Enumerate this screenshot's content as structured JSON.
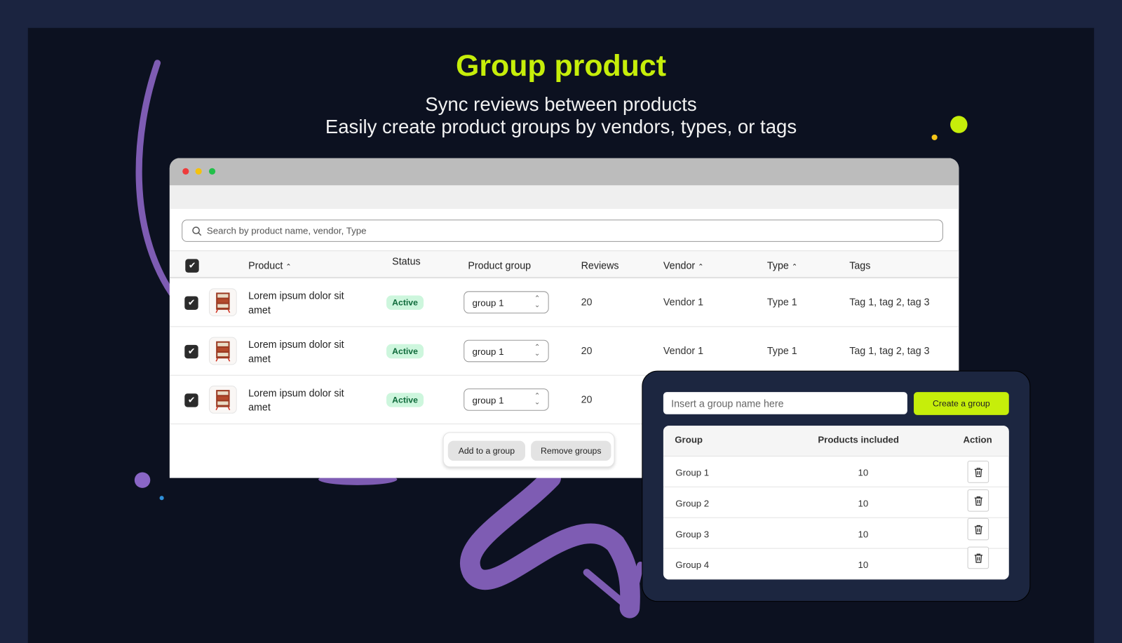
{
  "hero": {
    "title": "Group product",
    "subtitle_1": "Sync reviews between products",
    "subtitle_2": "Easily create product groups by vendors, types, or tags"
  },
  "colors": {
    "accent": "#c6ee0a",
    "swoosh": "#7e5cb3",
    "background": "#0c1120",
    "panel": "#1c2640"
  },
  "search": {
    "placeholder": "Search by product name, vendor, Type"
  },
  "table": {
    "headers": {
      "product": "Product",
      "status": "Status",
      "group": "Product group",
      "reviews": "Reviews",
      "vendor": "Vendor",
      "type": "Type",
      "tags": "Tags"
    },
    "rows": [
      {
        "name": "Lorem ipsum dolor sit amet",
        "status": "Active",
        "group": "group 1",
        "reviews": "20",
        "vendor": "Vendor 1",
        "type": "Type 1",
        "tags": "Tag 1, tag 2, tag 3",
        "checked": true
      },
      {
        "name": "Lorem ipsum dolor sit amet",
        "status": "Active",
        "group": "group 1",
        "reviews": "20",
        "vendor": "Vendor 1",
        "type": "Type 1",
        "tags": "Tag 1, tag 2, tag 3",
        "checked": true
      },
      {
        "name": "Lorem ipsum dolor sit amet",
        "status": "Active",
        "group": "group 1",
        "reviews": "20",
        "checked": true
      }
    ]
  },
  "bulk_actions": {
    "add": "Add to a group",
    "remove": "Remove groups"
  },
  "group_panel": {
    "input_placeholder": "Insert a group name here",
    "create_label": "Create a group",
    "headers": {
      "group": "Group",
      "products": "Products included",
      "action": "Action"
    },
    "rows": [
      {
        "name": "Group 1",
        "count": "10"
      },
      {
        "name": "Group 2",
        "count": "10"
      },
      {
        "name": "Group 3",
        "count": "10"
      },
      {
        "name": "Group 4",
        "count": "10"
      }
    ]
  }
}
